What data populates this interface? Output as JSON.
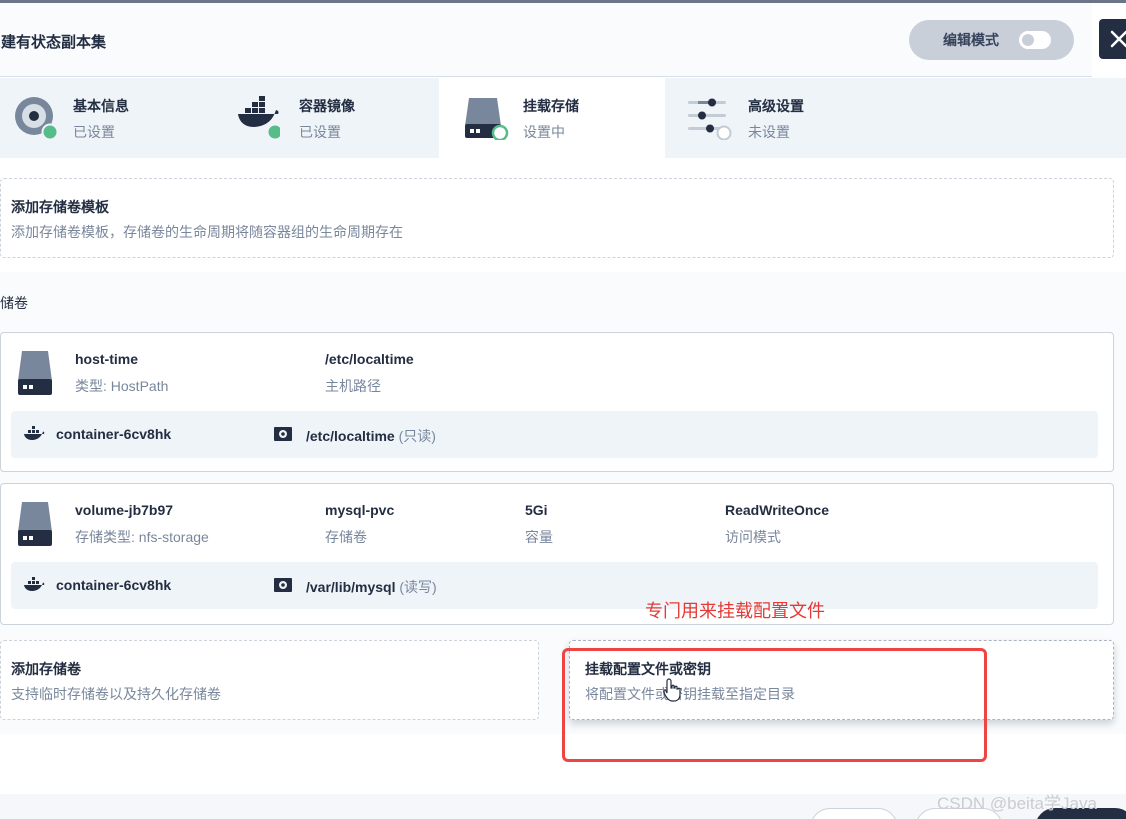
{
  "header": {
    "title": "创建有状态副本集",
    "edit_mode_label": "编辑模式"
  },
  "steps": [
    {
      "title": "基本信息",
      "status": "已设置",
      "icon": "disk-icon",
      "state": "done"
    },
    {
      "title": "容器镜像",
      "status": "已设置",
      "icon": "docker-icon",
      "state": "done"
    },
    {
      "title": "挂载存储",
      "status": "设置中",
      "icon": "storage-icon",
      "state": "active"
    },
    {
      "title": "高级设置",
      "status": "未设置",
      "icon": "sliders-icon",
      "state": "pending"
    }
  ],
  "template": {
    "title": "添加存储卷模板",
    "desc": "添加存储卷模板，存储卷的生命周期将随容器组的生命周期存在"
  },
  "section_label": "存储卷",
  "volumes": [
    {
      "name": "host-time",
      "sub": "类型: HostPath",
      "path": "/etc/localtime",
      "path_label": "主机路径",
      "mount": {
        "container": "container-6cv8hk",
        "path": "/etc/localtime",
        "mode": "(只读)"
      }
    },
    {
      "name": "volume-jb7b97",
      "sub": "存储类型: nfs-storage",
      "pvc": "mysql-pvc",
      "pvc_label": "存储卷",
      "capacity": "5Gi",
      "capacity_label": "容量",
      "access": "ReadWriteOnce",
      "access_label": "访问模式",
      "mount": {
        "container": "container-6cv8hk",
        "path": "/var/lib/mysql",
        "mode": "(读写)"
      }
    }
  ],
  "add_volume": {
    "title": "添加存储卷",
    "desc": "支持临时存储卷以及持久化存储卷"
  },
  "mount_config": {
    "title": "挂载配置文件或密钥",
    "desc": "将配置文件或密钥挂载至指定目录"
  },
  "annotation": "专门用来挂载配置文件",
  "watermark": "CSDN @beita学Java",
  "colors": {
    "accent": "#55bc8a",
    "dark": "#242e42",
    "annotation": "#ef4444"
  }
}
